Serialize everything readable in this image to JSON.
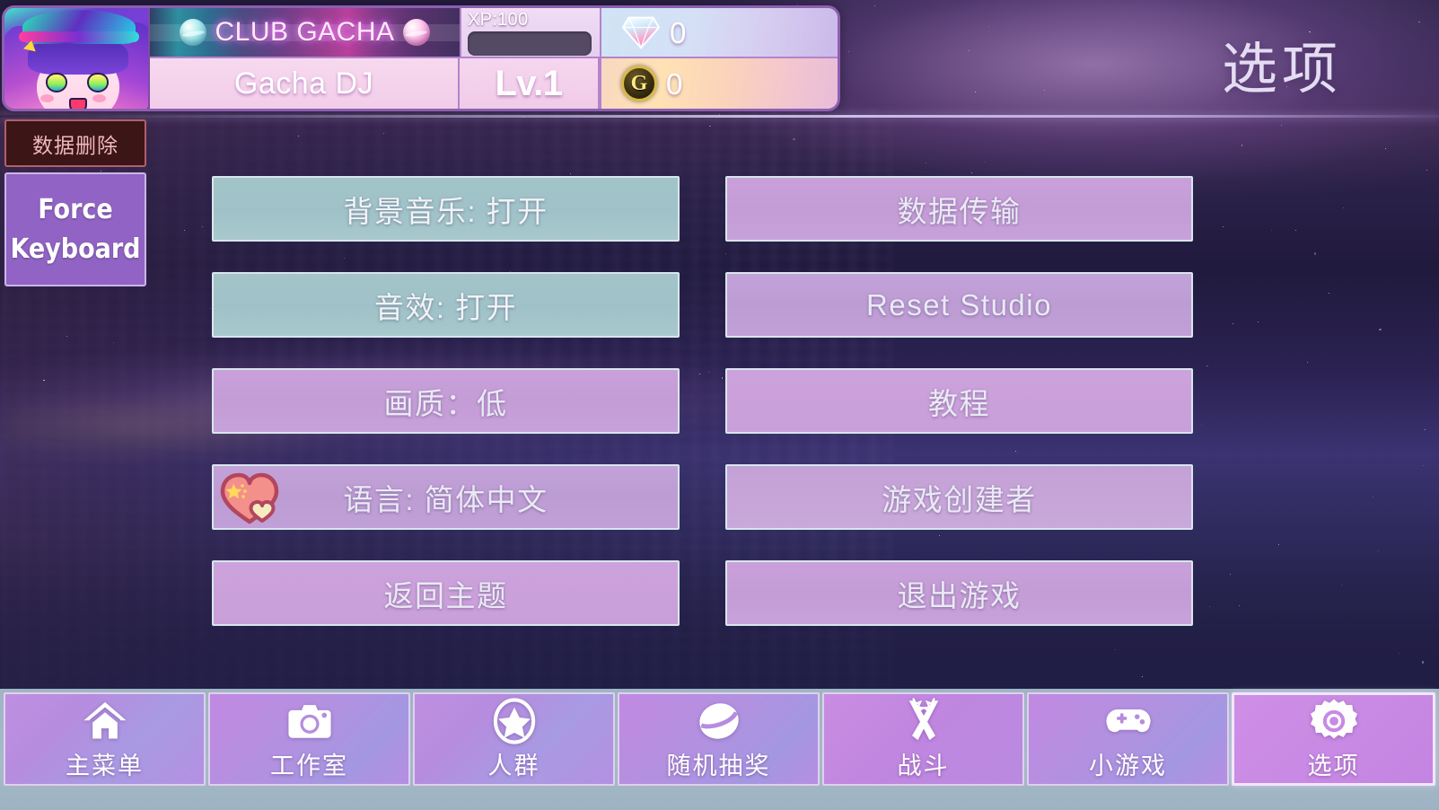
{
  "page": {
    "title": "选项"
  },
  "header": {
    "club_banner": "CLUB GACHA",
    "player_name": "Gacha DJ",
    "xp_label": "XP:100",
    "xp_percent": 0,
    "level": "Lv.1",
    "gems": "0",
    "coins": "0",
    "gem_icon": "diamond-icon",
    "coin_icon": "gold-coin-icon",
    "coin_letter": "G",
    "avatar_icon": "player-avatar"
  },
  "side_buttons": [
    {
      "id": "data-delete",
      "label": "数据删除",
      "style": "danger"
    },
    {
      "id": "force-keyboard",
      "label_line1": "Force",
      "label_line2": "Keyboard",
      "style": "purple"
    }
  ],
  "options": {
    "left_column": [
      {
        "id": "bgm",
        "label": "背景音乐: 打开",
        "style": "teal",
        "icon": null
      },
      {
        "id": "sfx",
        "label": "音效: 打开",
        "style": "teal",
        "icon": null
      },
      {
        "id": "quality",
        "label": "画质：低",
        "style": "pink",
        "icon": null
      },
      {
        "id": "language",
        "label": "语言: 简体中文",
        "style": "pinkB",
        "icon": "heart-flag-icon"
      },
      {
        "id": "theme",
        "label": "返回主题",
        "style": "pinkC",
        "icon": null
      }
    ],
    "right_column": [
      {
        "id": "data-transfer",
        "label": "数据传输",
        "style": "pink"
      },
      {
        "id": "reset-studio",
        "label": "Reset Studio",
        "style": "pinkB"
      },
      {
        "id": "tutorial",
        "label": "教程",
        "style": "pinkC"
      },
      {
        "id": "game-creator",
        "label": "游戏创建者",
        "style": "pinkD"
      },
      {
        "id": "quit-game",
        "label": "退出游戏",
        "style": "pink"
      }
    ]
  },
  "nav": [
    {
      "id": "home",
      "label": "主菜单",
      "icon": "home-icon",
      "active": false
    },
    {
      "id": "studio",
      "label": "工作室",
      "icon": "camera-icon",
      "active": false
    },
    {
      "id": "crowd",
      "label": "人群",
      "icon": "star-circle-icon",
      "active": false
    },
    {
      "id": "gacha",
      "label": "随机抽奖",
      "icon": "gacha-ball-icon",
      "active": false
    },
    {
      "id": "battle",
      "label": "战斗",
      "icon": "battle-icon",
      "active": false
    },
    {
      "id": "minigames",
      "label": "小游戏",
      "icon": "gamepad-icon",
      "active": false
    },
    {
      "id": "options",
      "label": "选项",
      "icon": "gear-icon",
      "active": true
    }
  ],
  "colors": {
    "danger_bg": "#3c1517",
    "danger_text": "#f0b8bb",
    "force_bg": "#9163c4",
    "teal_button": "#a2c4c9",
    "pink_button": "#c49cd6",
    "nav_bar": "#a6bac8",
    "nav_button": "#b68cdf",
    "nav_active": "#c88ae4",
    "title_text": "#e3dcf2"
  }
}
